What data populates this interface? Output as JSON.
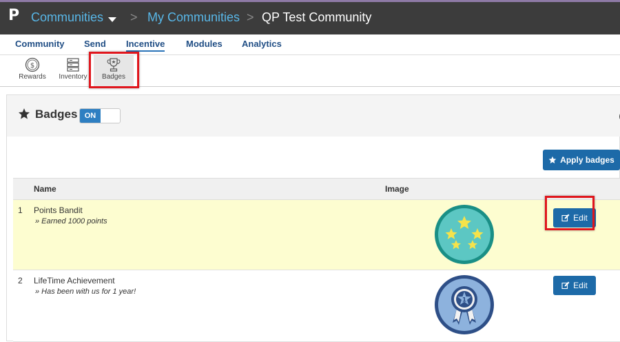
{
  "topbar": {
    "logo": "P",
    "breadcrumb": [
      {
        "label": "Communities"
      },
      {
        "sep": ">"
      },
      {
        "label": "My Communities"
      },
      {
        "sep": ">"
      },
      {
        "label": "QP Test Community"
      }
    ]
  },
  "tabs": [
    {
      "label": "Community"
    },
    {
      "label": "Send"
    },
    {
      "label": "Incentive",
      "active": true
    },
    {
      "label": "Modules"
    },
    {
      "label": "Analytics"
    }
  ],
  "subnav": [
    {
      "label": "Rewards",
      "icon": "dollar-coin-icon"
    },
    {
      "label": "Inventory",
      "icon": "inventory-icon"
    },
    {
      "label": "Badges",
      "icon": "trophy-icon",
      "active": true
    }
  ],
  "panel": {
    "title": "Badges",
    "toggle_label": "ON",
    "apply_button": "Apply badges",
    "columns": [
      "Name",
      "Image"
    ],
    "rows": [
      {
        "index": "1",
        "name": "Points Bandit",
        "description": "» Earned 1000 points",
        "image": "stars-badge",
        "edit_label": "Edit"
      },
      {
        "index": "2",
        "name": "LifeTime Achievement",
        "description": "» Has been with us for 1 year!",
        "image": "ribbon-badge",
        "edit_label": "Edit"
      }
    ]
  },
  "colors": {
    "topbar": "#3c3c3c",
    "link": "#58b7e8",
    "tab": "#1f4d84",
    "button": "#1d6aa8",
    "highlight_row": "#fdfdd0",
    "annotation": "#e0161d"
  }
}
